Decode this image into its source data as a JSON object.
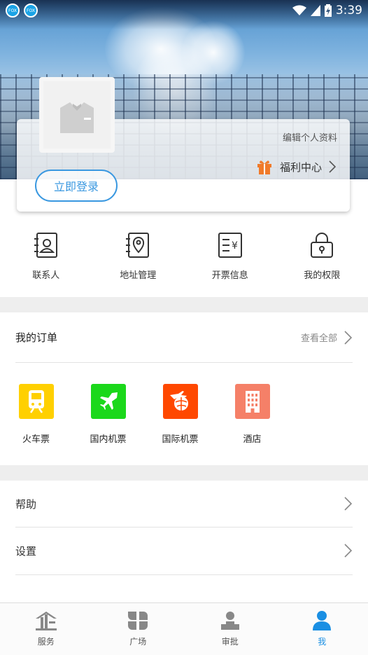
{
  "status_bar": {
    "time": "3:39",
    "notification_icons": [
      "app-notification-icon",
      "app-notification-icon"
    ],
    "notification_text": [
      "FOX",
      "FOX"
    ]
  },
  "profile": {
    "edit_link": "编辑个人资料",
    "welfare_label": "福利中心",
    "login_button": "立即登录"
  },
  "quick_actions": [
    {
      "label": "联系人",
      "icon": "contact-book-icon"
    },
    {
      "label": "地址管理",
      "icon": "location-pin-icon"
    },
    {
      "label": "开票信息",
      "icon": "invoice-yen-icon"
    },
    {
      "label": "我的权限",
      "icon": "lock-icon"
    }
  ],
  "orders": {
    "title": "我的订单",
    "view_all": "查看全部",
    "services": [
      {
        "label": "火车票",
        "icon": "train-icon",
        "color": "#ffd000"
      },
      {
        "label": "国内机票",
        "icon": "airplane-icon",
        "color": "#1bd81b"
      },
      {
        "label": "国际机票",
        "icon": "globe-plane-icon",
        "color": "#ff4800"
      },
      {
        "label": "酒店",
        "icon": "hotel-icon",
        "color": "#f58068"
      }
    ]
  },
  "menu": {
    "help": "帮助",
    "settings": "设置"
  },
  "tabs": [
    {
      "label": "服务",
      "icon": "service-icon",
      "active": false
    },
    {
      "label": "广场",
      "icon": "square-icon",
      "active": false
    },
    {
      "label": "审批",
      "icon": "approval-icon",
      "active": false
    },
    {
      "label": "我",
      "icon": "me-icon",
      "active": true
    }
  ],
  "colors": {
    "accent": "#3a98e0",
    "active_tab": "#1a8fe3",
    "section_gap": "#eeeeee"
  }
}
